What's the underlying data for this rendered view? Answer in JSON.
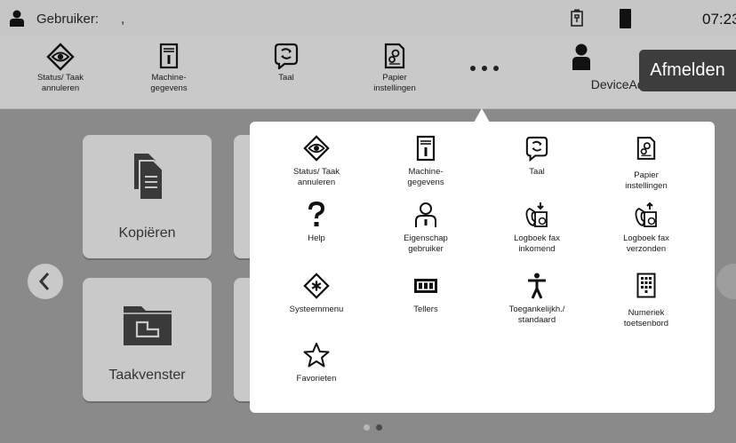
{
  "status_bar": {
    "user_label": "Gebruiker:",
    "user_name": ",",
    "time": "07:23"
  },
  "toolbar": {
    "items": [
      {
        "label": "Status/ Taak annuleren",
        "icon": "status-eye-icon"
      },
      {
        "label": "Machine-gegevens",
        "icon": "machine-info-icon"
      },
      {
        "label": "Taal",
        "icon": "language-icon"
      },
      {
        "label": "Papier instellingen",
        "icon": "paper-settings-icon"
      }
    ],
    "more_icon": "more-dots-icon",
    "admin_label": "DeviceAdmin",
    "logout_label": "Afmelden"
  },
  "home": {
    "tiles": [
      {
        "label": "Kopiëren",
        "icon": "copy-icon"
      },
      {
        "label": "Taakvenster",
        "icon": "job-box-icon"
      }
    ],
    "page_count": 2,
    "current_page": 2
  },
  "popup": {
    "items": [
      {
        "label": "Status/ Taak annuleren",
        "icon": "status-eye-icon"
      },
      {
        "label": "Machine-gegevens",
        "icon": "machine-info-icon"
      },
      {
        "label": "Taal",
        "icon": "language-icon"
      },
      {
        "label": "Papier instellingen",
        "icon": "paper-settings-icon"
      },
      {
        "label": "Help",
        "icon": "help-icon"
      },
      {
        "label": "Eigenschap gebruiker",
        "icon": "user-property-icon"
      },
      {
        "label": "Logboek fax inkomend",
        "icon": "fax-in-log-icon"
      },
      {
        "label": "Logboek fax verzonden",
        "icon": "fax-out-log-icon"
      },
      {
        "label": "Systeemmenu",
        "icon": "system-menu-icon"
      },
      {
        "label": "Tellers",
        "icon": "counter-icon"
      },
      {
        "label": "Toegankelijkh./ standaard",
        "icon": "accessibility-icon"
      },
      {
        "label": "Numeriek toetsenbord",
        "icon": "numeric-keypad-icon"
      },
      {
        "label": "Favorieten",
        "icon": "favorites-star-icon"
      }
    ]
  },
  "colors": {
    "overlay_bg": "#8a8a8a",
    "bar_bg": "#c9c9c9",
    "logout_bg": "#3d3d3d",
    "popup_bg": "#ffffff"
  }
}
